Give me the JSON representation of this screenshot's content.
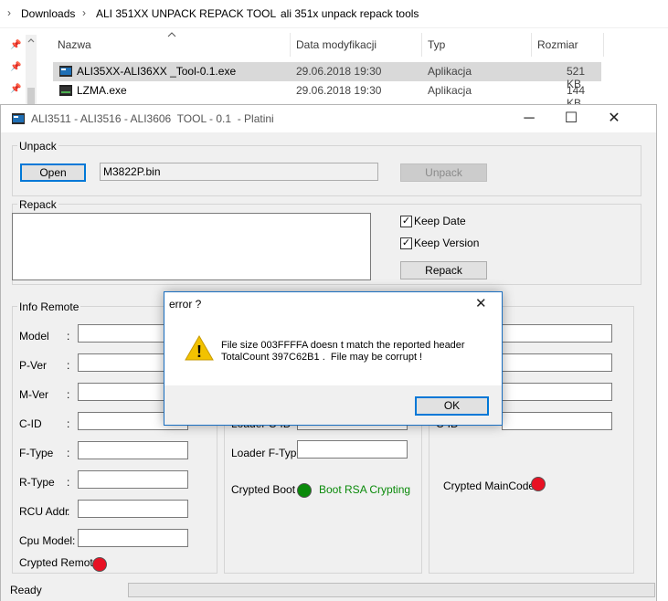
{
  "explorer": {
    "breadcrumbs": [
      "Downloads",
      "ALI 351XX UNPACK REPACK TOOL",
      "ali 351x unpack repack tools"
    ],
    "breadcrumb_sep": "›",
    "columns": [
      "Nazwa",
      "Data modyfikacji",
      "Typ",
      "Rozmiar"
    ],
    "files": [
      {
        "name": "ALI35XX-ALI36XX _Tool-0.1.exe",
        "date": "29.06.2018 19:30",
        "type": "Aplikacja",
        "size": "521 KB"
      },
      {
        "name": "LZMA.exe",
        "date": "29.06.2018 19:30",
        "type": "Aplikacja",
        "size": "144 KB"
      }
    ]
  },
  "window": {
    "title": "ALI3511 - ALI3516 - ALI3606  TOOL - 0.1  - Platini",
    "minimize_glyph": "─",
    "maximize_glyph": "☐",
    "close_glyph": "✕"
  },
  "unpack": {
    "label": "Unpack",
    "open_button": "Open",
    "file_value": "M3822P.bin",
    "unpack_button": "Unpack"
  },
  "repack": {
    "label": "Repack",
    "keep_date_label": "Keep Date",
    "keep_date_checked": true,
    "keep_version_label": "Keep Version",
    "keep_version_checked": true,
    "repack_button": "Repack",
    "check_glyph": "✓"
  },
  "info_remote": {
    "label": "Info Remote",
    "fields": [
      "Model",
      "P-Ver",
      "M-Ver",
      "C-ID",
      "F-Type",
      "R-Type",
      "RCU Addr",
      "Cpu Model:"
    ],
    "colon": ":",
    "crypted_label": "Crypted Remote",
    "crypted_color": "#e81123"
  },
  "loader": {
    "cid_label": "Loader C-ID",
    "ftype_label": "Loader F-Type:",
    "crypted_boot_label": "Crypted Boot",
    "boot_rsa_label": "Boot RSA Crypting",
    "boot_color": "#0a8a0a"
  },
  "maincode": {
    "cid_label": "C-ID",
    "crypted_label": "Crypted MainCode",
    "crypted_color": "#e81123"
  },
  "status": {
    "text": "Ready"
  },
  "dialog": {
    "title": "error ?",
    "message_line1": "File size 003FFFFA doesn t match the reported header",
    "message_line2": "TotalCount 397C62B1 .  File may be corrupt !",
    "ok_button": "OK",
    "close_glyph": "✕",
    "warning_glyph": "!"
  }
}
